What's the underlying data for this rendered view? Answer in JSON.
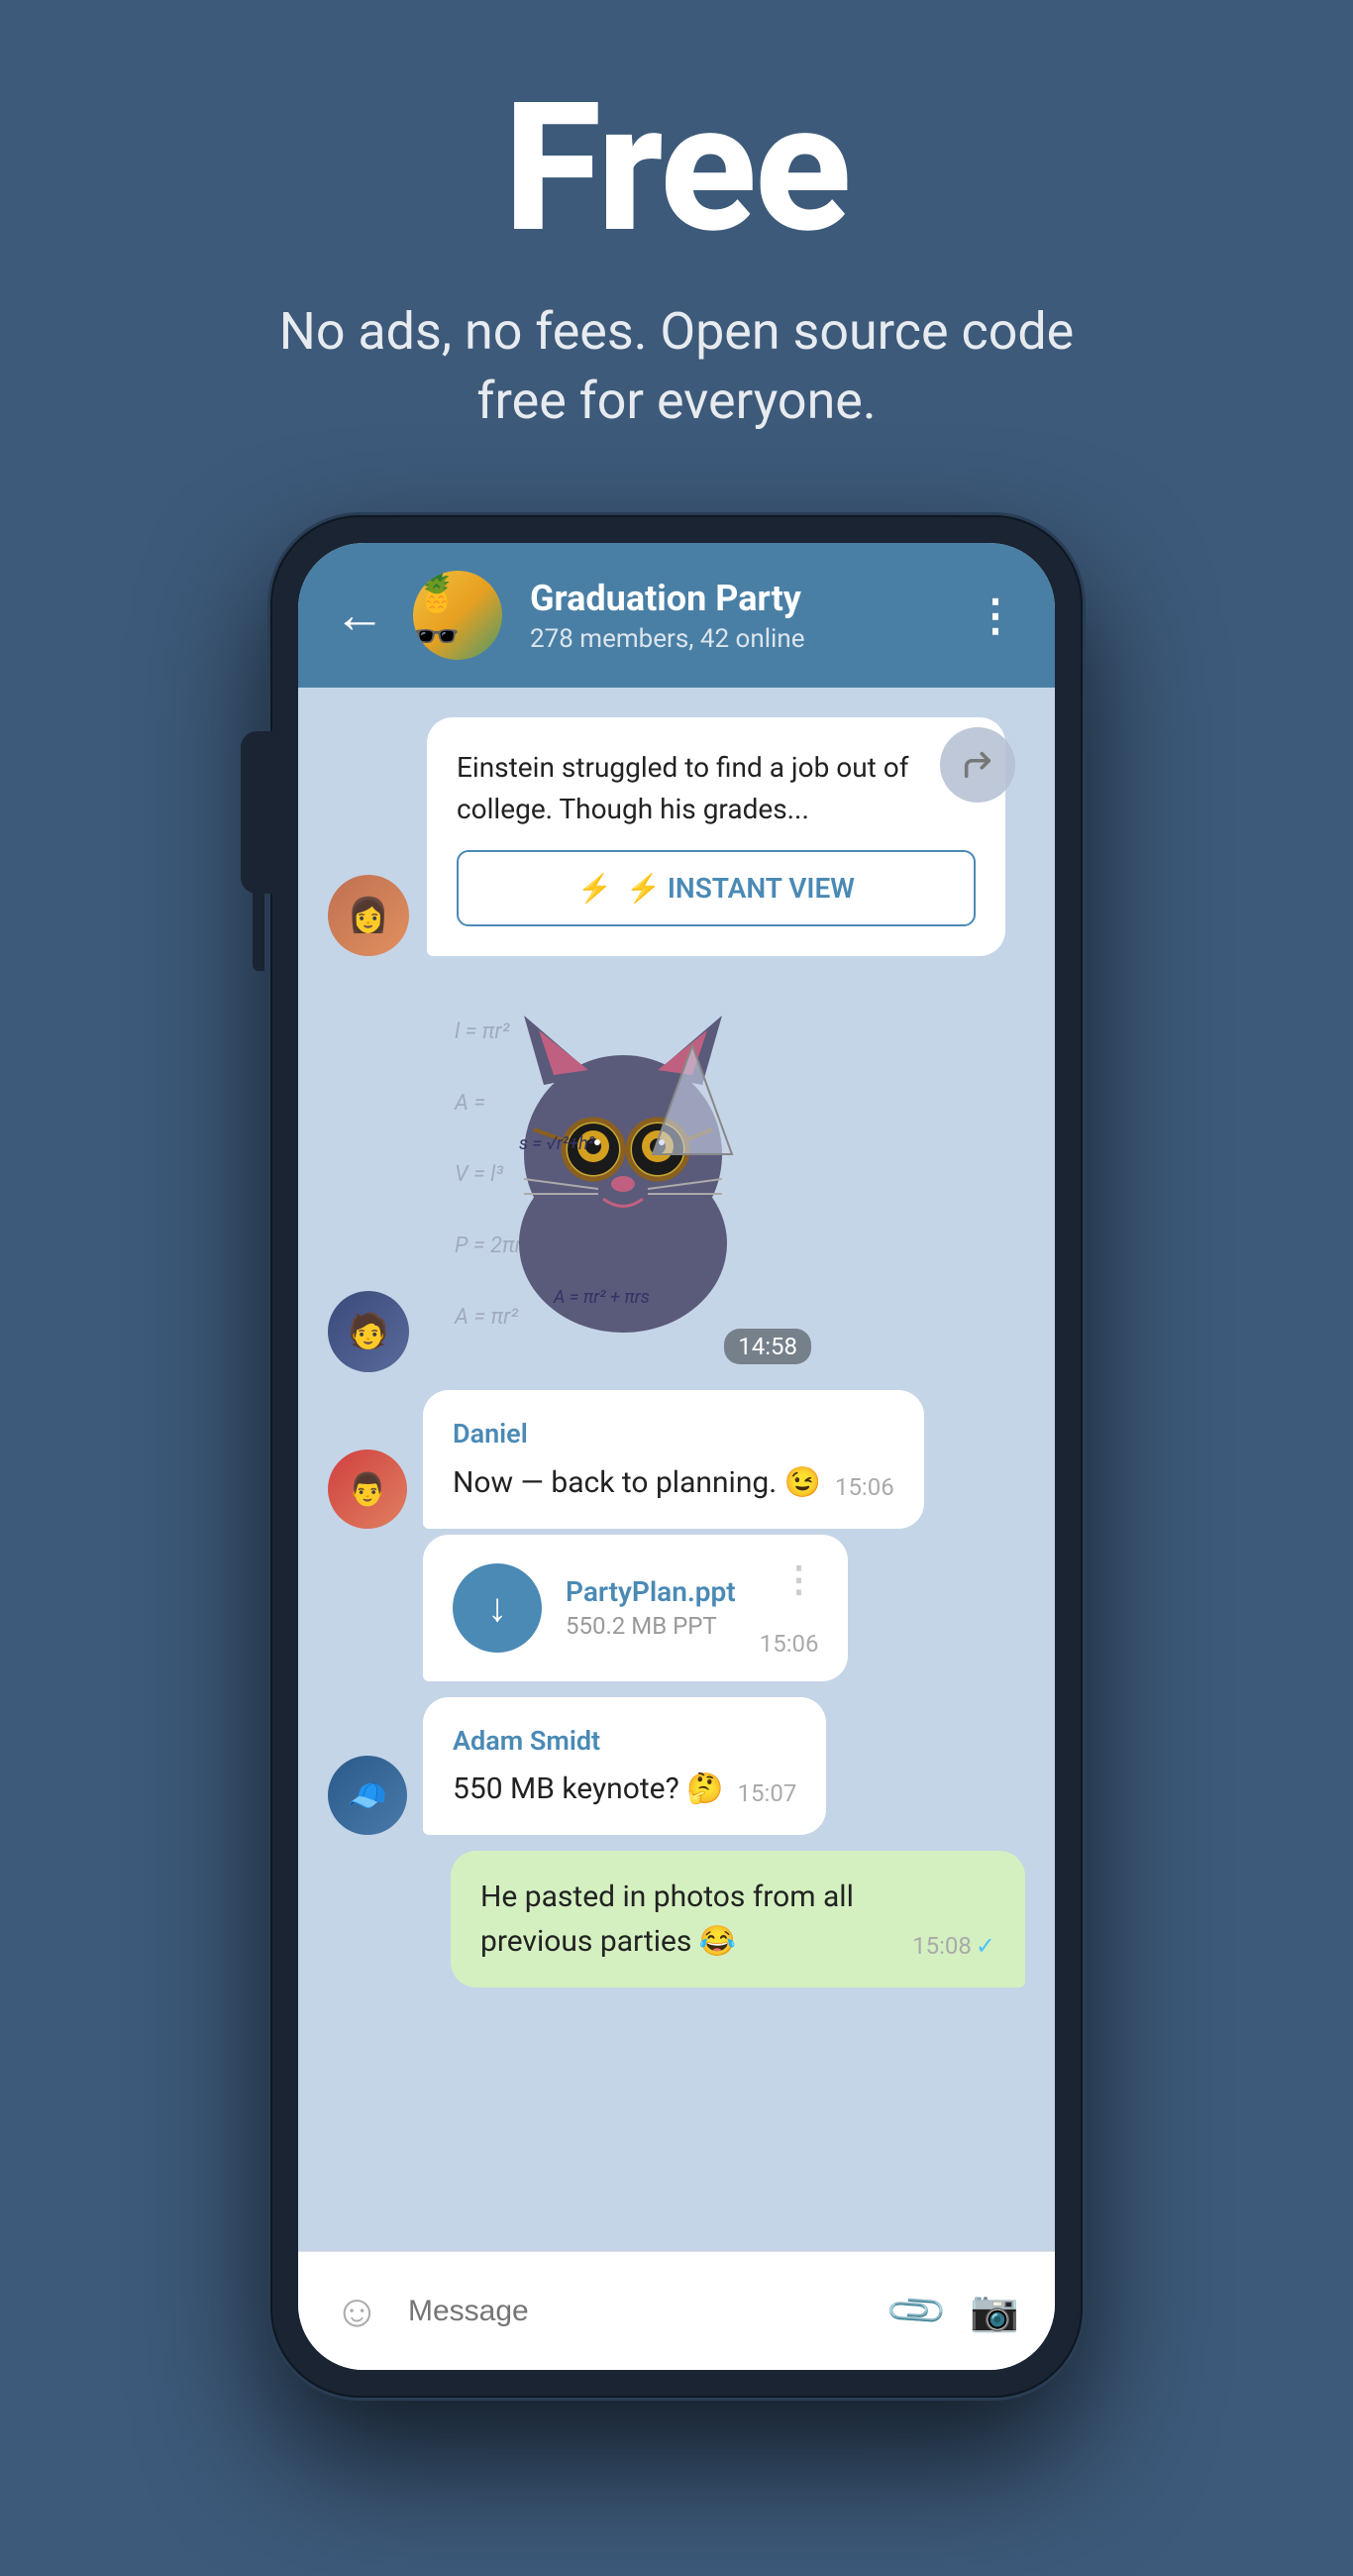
{
  "hero": {
    "title": "Free",
    "subtitle": "No ads, no fees. Open source code free for everyone."
  },
  "header": {
    "back_label": "←",
    "group_name": "Graduation Party",
    "group_meta": "278 members, 42 online",
    "menu_label": "⋮",
    "group_emoji": "🍍"
  },
  "messages": [
    {
      "id": "article",
      "type": "article",
      "text": "Einstein struggled to find a job out of college. Though his grades...",
      "button": "⚡ INSTANT VIEW"
    },
    {
      "id": "sticker",
      "type": "sticker",
      "time": "14:58"
    },
    {
      "id": "daniel-msg",
      "type": "incoming",
      "sender": "Daniel",
      "text": "Now — back to planning. 😉",
      "time": "15:06"
    },
    {
      "id": "file-msg",
      "type": "file",
      "filename": "PartyPlan.ppt",
      "size": "550.2 MB PPT",
      "time": "15:06"
    },
    {
      "id": "adam-msg",
      "type": "incoming",
      "sender": "Adam Smidt",
      "text": "550 MB keynote? 🤔",
      "time": "15:07"
    },
    {
      "id": "outgoing-msg",
      "type": "outgoing",
      "text": "He pasted in photos from all previous parties 😂",
      "time": "15:08",
      "read": true
    }
  ],
  "message_bar": {
    "placeholder": "Message"
  },
  "formulas": [
    "l = πr",
    "A = πr²",
    "V = l³",
    "P = 2πr",
    "A = πr²",
    "s = √r² + h²",
    "A = πr² + πrs"
  ]
}
